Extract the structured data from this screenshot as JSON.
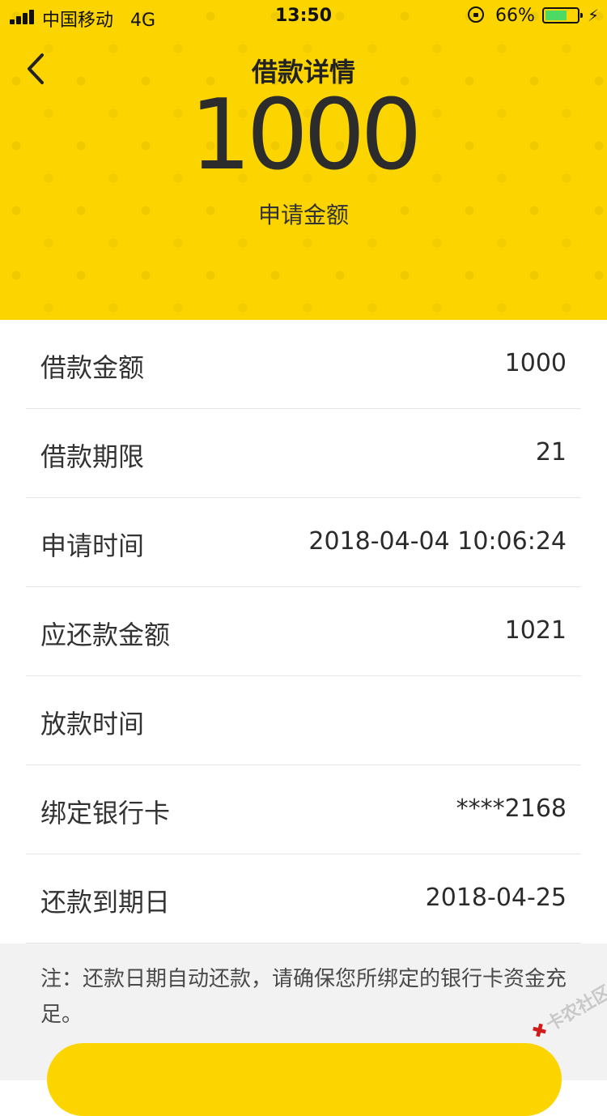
{
  "status_bar": {
    "carrier": "中国移动",
    "network": "4G",
    "time": "13:50",
    "battery": "66%",
    "battery_level": 0.66,
    "battery_color": "#4cd964"
  },
  "nav": {
    "back_icon": "chevron-left-icon",
    "title": "借款详情"
  },
  "hero": {
    "amount": "1000",
    "amount_label": "申请金额",
    "background_color": "#fcd500"
  },
  "details": [
    {
      "label": "借款金额",
      "value": "1000"
    },
    {
      "label": "借款期限",
      "value": "21"
    },
    {
      "label": "申请时间",
      "value": "2018-04-04 10:06:24"
    },
    {
      "label": "应还款金额",
      "value": "1021"
    },
    {
      "label": "放款时间",
      "value": ""
    },
    {
      "label": "绑定银行卡",
      "value": "****2168"
    },
    {
      "label": "还款到期日",
      "value": "2018-04-25"
    }
  ],
  "note": {
    "text": "注：还款日期自动还款，请确保您所绑定的银行卡资金充足。"
  },
  "watermark": {
    "text": "卡农社区"
  }
}
